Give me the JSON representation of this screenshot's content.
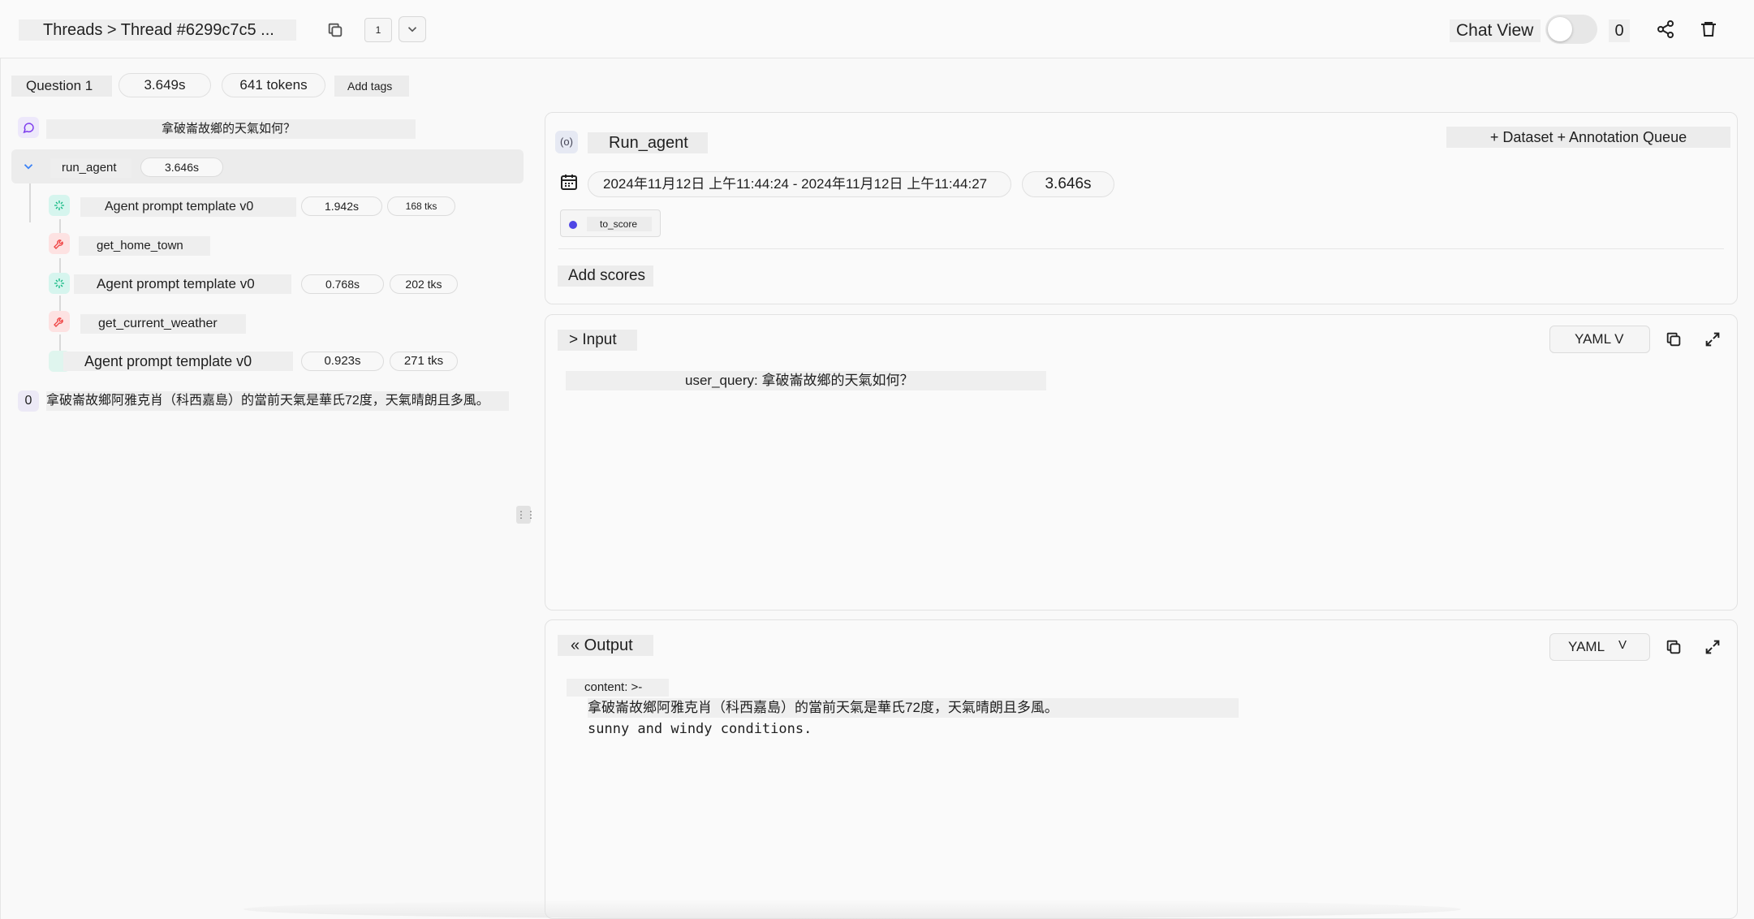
{
  "header": {
    "breadcrumb": "Threads > Thread #6299c7c5 ...",
    "page_count": "1",
    "chat_view_label": "Chat View",
    "chat_view_enabled": false,
    "feedback_count": "0"
  },
  "summary": {
    "question_label": "Question 1",
    "duration": "3.649s",
    "tokens": "641 tokens",
    "add_tags_label": "Add tags"
  },
  "trace": {
    "user_message": "拿破崙故鄉的天氣如何？",
    "root": {
      "name": "run_agent",
      "latency": "3.646s"
    },
    "children": [
      {
        "name": "Agent prompt template v0",
        "latency": "1.942s",
        "tokens": "168 tks",
        "type": "llm"
      },
      {
        "name": "get_home_town",
        "type": "tool"
      },
      {
        "name": "Agent prompt template v0",
        "latency": "0.768s",
        "tokens": "202 tks",
        "type": "llm"
      },
      {
        "name": "get_current_weather",
        "type": "tool"
      },
      {
        "name": "Agent prompt template v0",
        "latency": "0.923s",
        "tokens": "271 tks",
        "type": "llm"
      }
    ],
    "final_output_index": "0",
    "final_output": "拿破崙故鄉阿雅克肖（科西嘉島）的當前天氣是華氏72度，天氣晴朗且多風。"
  },
  "run": {
    "icon_text": "(o)",
    "name": "Run_agent",
    "dataset_button": "+ Dataset + Annotation Queue",
    "time_range": "2024年11月12日 上午11:44:24 - 2024年11月12日 上午11:44:27",
    "duration": "3.646s",
    "score_label": "to_score",
    "add_scores_label": "Add scores"
  },
  "input": {
    "title": "> Input",
    "format": "YAML V",
    "query_line": "user_query: 拿破崙故鄉的天氣如何？"
  },
  "output": {
    "title": "« Output",
    "format_label": "YAML",
    "format_caret": "V",
    "content_key": "content: >-",
    "content_line1": "拿破崙故鄉阿雅克肖（科西嘉島）的當前天氣是華氏72度，天氣晴朗且多風。",
    "content_line2": "sunny and windy conditions."
  },
  "colors": {
    "accent": "#4f46e5",
    "llm_icon_bg": "#d6f5ee",
    "llm_icon_fg": "#10b981",
    "tool_icon_bg": "#fde2e2",
    "tool_icon_fg": "#ef4444",
    "chat_icon_fg": "#7c3aed"
  }
}
